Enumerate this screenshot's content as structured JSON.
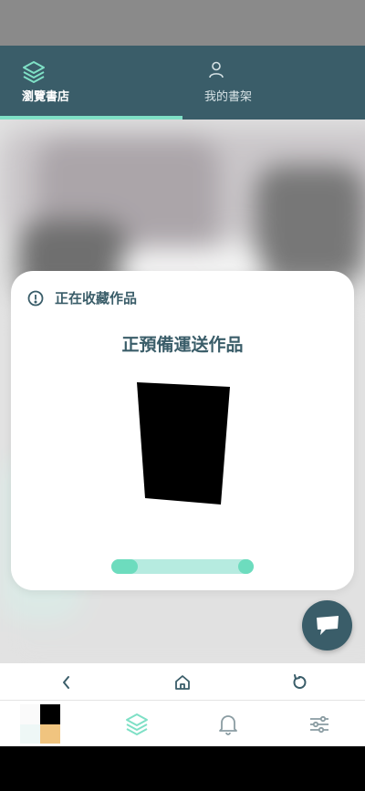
{
  "top_tabs": {
    "store_label": "瀏覽書店",
    "shelf_label": "我的書架",
    "active": "store"
  },
  "dialog": {
    "header": "正在收藏作品",
    "title": "正預備運送作品",
    "progress": 0.1
  },
  "colors": {
    "brand": "#3a5d69",
    "accent": "#7fe0c6",
    "progress_track": "#b6ebe0",
    "progress_fill": "#6ddcbe"
  },
  "icons": {
    "store_tab": "layers-icon",
    "shelf_tab": "user-icon",
    "dialog_header": "info-icon",
    "chat": "chat-icon",
    "browser_back": "chevron-left-icon",
    "browser_home": "home-icon",
    "browser_reload": "reload-icon",
    "bottom_library": "layers-icon",
    "bottom_notifications": "bell-icon",
    "bottom_settings": "sliders-icon"
  }
}
